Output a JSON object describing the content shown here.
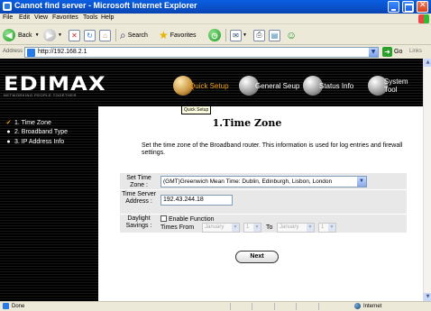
{
  "window": {
    "title": "Cannot find server - Microsoft Internet Explorer"
  },
  "menu": [
    "File",
    "Edit",
    "View",
    "Favorites",
    "Tools",
    "Help"
  ],
  "toolbar": {
    "back_label": "Back",
    "search_label": "Search",
    "favorites_label": "Favorites"
  },
  "address": {
    "label": "Address",
    "url": "http://192.168.2.1",
    "go_label": "Go",
    "links_label": "Links"
  },
  "banner": {
    "logo": "EDIMAX",
    "logo_sub": "NETWORKING PEOPLE TOGETHER",
    "nav": [
      {
        "label": "Quick Setup",
        "active": true
      },
      {
        "label": "General Seup",
        "active": false
      },
      {
        "label": "Status Info",
        "active": false
      },
      {
        "label": "System Tool",
        "active": false
      }
    ],
    "tooltip": "Quick Setup"
  },
  "sidebar": {
    "items": [
      {
        "label": "1. Time Zone",
        "marker": "✔"
      },
      {
        "label": "2. Broadband Type",
        "marker": "●"
      },
      {
        "label": "3. IP Address Info",
        "marker": "●"
      }
    ]
  },
  "content": {
    "title": "1.Time Zone",
    "description": "Set the time zone of the Broadband router. This information is used for log entries and firewall settings.",
    "timezone_label": "Set Time Zone :",
    "timezone_value": "(GMT)Greenwich Mean Time: Dublin, Edinburgh, Lisbon, London",
    "server_label": "Time Server Address :",
    "server_value": "192.43.244.18",
    "daylight_label": "Daylight Savings :",
    "enable_label": "Enable Function",
    "times_from_label": "Times From",
    "from_month": "January",
    "from_day": "1",
    "to_label": "To",
    "to_month": "January",
    "to_day": "1",
    "next_label": "Next"
  },
  "status": {
    "left": "Done",
    "zone": "Internet"
  }
}
